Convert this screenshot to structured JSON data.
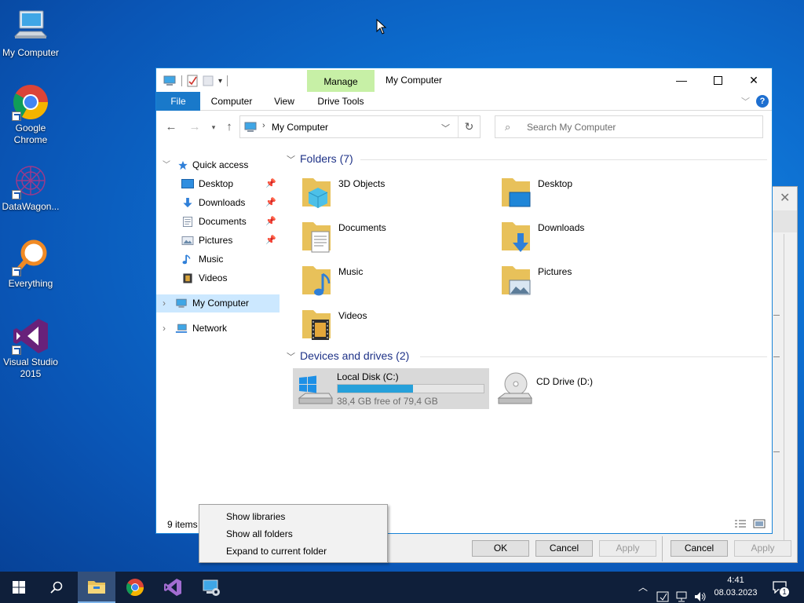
{
  "desktop": {
    "icons": [
      {
        "label": "My Computer"
      },
      {
        "label": "Google Chrome"
      },
      {
        "label": "DataWagon..."
      },
      {
        "label": "Everything"
      },
      {
        "label": "Visual Studio 2015"
      }
    ]
  },
  "window": {
    "title": "My Computer",
    "contextual_tab": "Manage",
    "ribbon_tabs": [
      "File",
      "Computer",
      "View",
      "Drive Tools"
    ],
    "address": "My Computer",
    "search_placeholder": "Search My Computer",
    "status": "9 items"
  },
  "navpane": {
    "quick_access": "Quick access",
    "items": [
      {
        "label": "Desktop",
        "pinned": true
      },
      {
        "label": "Downloads",
        "pinned": true
      },
      {
        "label": "Documents",
        "pinned": true
      },
      {
        "label": "Pictures",
        "pinned": true
      },
      {
        "label": "Music",
        "pinned": false
      },
      {
        "label": "Videos",
        "pinned": false
      }
    ],
    "my_computer": "My Computer",
    "network": "Network"
  },
  "content": {
    "folders_header": "Folders (7)",
    "folders": [
      "3D Objects",
      "Desktop",
      "Documents",
      "Downloads",
      "Music",
      "Pictures",
      "Videos"
    ],
    "devices_header": "Devices and drives (2)",
    "drives": [
      {
        "name": "Local Disk (C:)",
        "free": "38,4 GB free of 79,4 GB",
        "used_fraction": 0.516
      },
      {
        "name": "CD Drive (D:)"
      }
    ]
  },
  "context_menu": {
    "items": [
      "Show libraries",
      "Show all folders",
      "Expand to current folder"
    ]
  },
  "dialog": {
    "buttons": [
      "OK",
      "Cancel",
      "Apply",
      "Cancel",
      "Apply"
    ]
  },
  "taskbar": {
    "time": "4:41",
    "date": "08.03.2023",
    "notification_count": "1"
  },
  "colors": {
    "accent": "#1979ca",
    "manage_tab": "#c7f0a6",
    "drive_bar": "#26a0da",
    "selection": "#cce8ff"
  }
}
